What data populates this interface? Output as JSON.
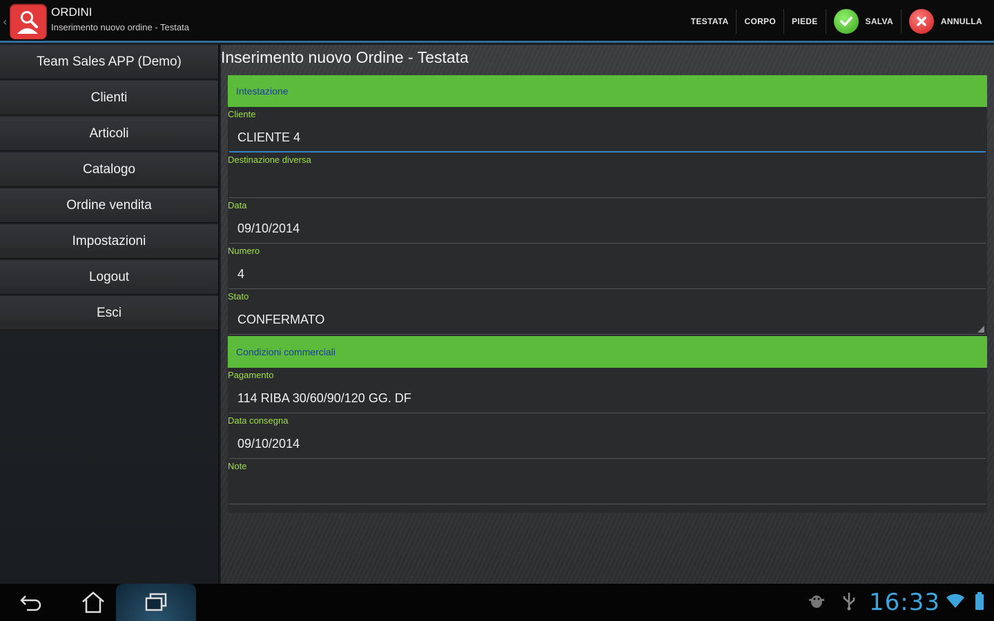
{
  "actionbar": {
    "title": "ORDINI",
    "subtitle": "Inserimento nuovo ordine - Testata",
    "tabs": [
      "TESTATA",
      "CORPO",
      "PIEDE"
    ],
    "save_label": "SALVA",
    "cancel_label": "ANNULLA",
    "icons": [
      "app-logo-icon",
      "checkmark-icon",
      "close-icon"
    ],
    "colors": {
      "accent": "#2f6e9a",
      "save": "#3aa51d",
      "cancel": "#d01c1c",
      "app_icon_bg": "#e23a3a"
    }
  },
  "sidebar": {
    "items": [
      {
        "label": "Team Sales APP (Demo)"
      },
      {
        "label": "Clienti"
      },
      {
        "label": "Articoli"
      },
      {
        "label": "Catalogo"
      },
      {
        "label": "Ordine vendita"
      },
      {
        "label": "Impostazioni"
      },
      {
        "label": "Logout"
      },
      {
        "label": "Esci"
      }
    ]
  },
  "main": {
    "page_title": "Inserimento nuovo Ordine - Testata",
    "sections": [
      {
        "title": "Intestazione",
        "fields": [
          {
            "label": "Cliente",
            "value": "CLIENTE 4"
          },
          {
            "label": "Destinazione diversa",
            "value": ""
          },
          {
            "label": "Data",
            "value": "09/10/2014"
          },
          {
            "label": "Numero",
            "value": "4"
          },
          {
            "label": "Stato",
            "value": "CONFERMATO"
          }
        ]
      },
      {
        "title": "Condizioni commerciali",
        "fields": [
          {
            "label": "Pagamento",
            "value": "114  RIBA 30/60/90/120 GG. DF"
          },
          {
            "label": "Data consegna",
            "value": "09/10/2014"
          },
          {
            "label": "Note",
            "value": ""
          }
        ]
      }
    ],
    "colors": {
      "section_bg": "#5cbb3a",
      "section_text": "#1c3aa8",
      "label": "#9ee04a",
      "focus": "#2f86c8"
    }
  },
  "system": {
    "clock": "16:33",
    "icons": [
      "back-icon",
      "home-icon",
      "recent-apps-icon",
      "android-debug-icon",
      "usb-icon",
      "wifi-icon",
      "battery-icon"
    ],
    "clock_color": "#3da5de"
  }
}
